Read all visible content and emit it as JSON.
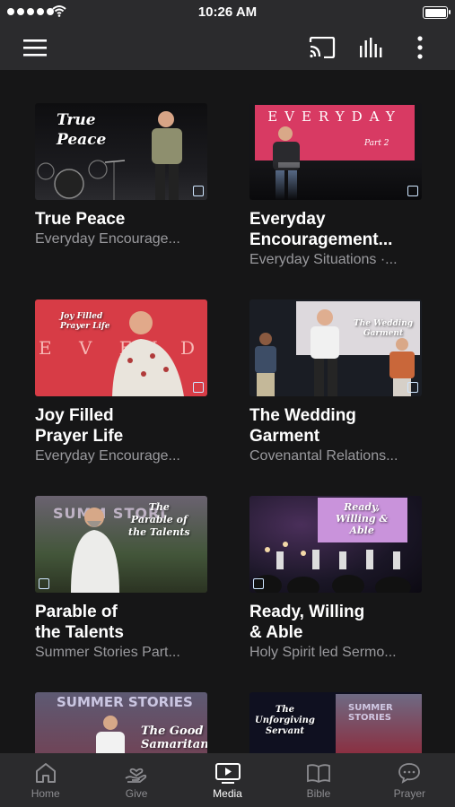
{
  "status_bar": {
    "time": "10:26 AM"
  },
  "top_bar": {
    "menu_icon": "hamburger-menu-icon",
    "cast_icon": "cast-icon",
    "audio_icon": "audio-bars-icon",
    "more_icon": "more-vertical-icon"
  },
  "media": [
    {
      "title": "True Peace",
      "subtitle": "Everyday Encourage...",
      "thumb_text": "True\nPeace"
    },
    {
      "title": "Everyday\nEncouragement...",
      "subtitle": "Everyday Situations ·...",
      "thumb_text": "EVERYDAY",
      "thumb_sub": "Part 2"
    },
    {
      "title": "Joy Filled\nPrayer Life",
      "subtitle": "Everyday Encourage...",
      "thumb_text": "Joy Filled\nPrayer Life"
    },
    {
      "title": "The Wedding\nGarment",
      "subtitle": "Covenantal Relations...",
      "thumb_text": "The Wedding\nGarment"
    },
    {
      "title": "Parable of\nthe Talents",
      "subtitle": "Summer Stories Part...",
      "thumb_text": "The\nParable of\nthe Talents"
    },
    {
      "title": "Ready, Willing\n& Able",
      "subtitle": "Holy Spirit led Sermo...",
      "thumb_text": "Ready,\nWilling &\nAble"
    },
    {
      "title": "",
      "subtitle": "",
      "thumb_text": "The Good\nSamaritan",
      "thumb_banner": "SUMMER STORIES"
    },
    {
      "title": "",
      "subtitle": "",
      "thumb_text": "The\nUnforgiving\nServant",
      "thumb_banner": "SUMMER STORIES"
    }
  ],
  "tabs": [
    {
      "label": "Home",
      "icon": "home-icon",
      "active": false
    },
    {
      "label": "Give",
      "icon": "give-hand-heart-icon",
      "active": false
    },
    {
      "label": "Media",
      "icon": "media-play-icon",
      "active": true
    },
    {
      "label": "Bible",
      "icon": "bible-book-icon",
      "active": false
    },
    {
      "label": "Prayer",
      "icon": "prayer-chat-icon",
      "active": false
    }
  ],
  "colors": {
    "background": "#161617",
    "bar": "#2b2b2d",
    "subtitle": "#9a9a9e",
    "inactive_tab": "#8c8c90"
  }
}
